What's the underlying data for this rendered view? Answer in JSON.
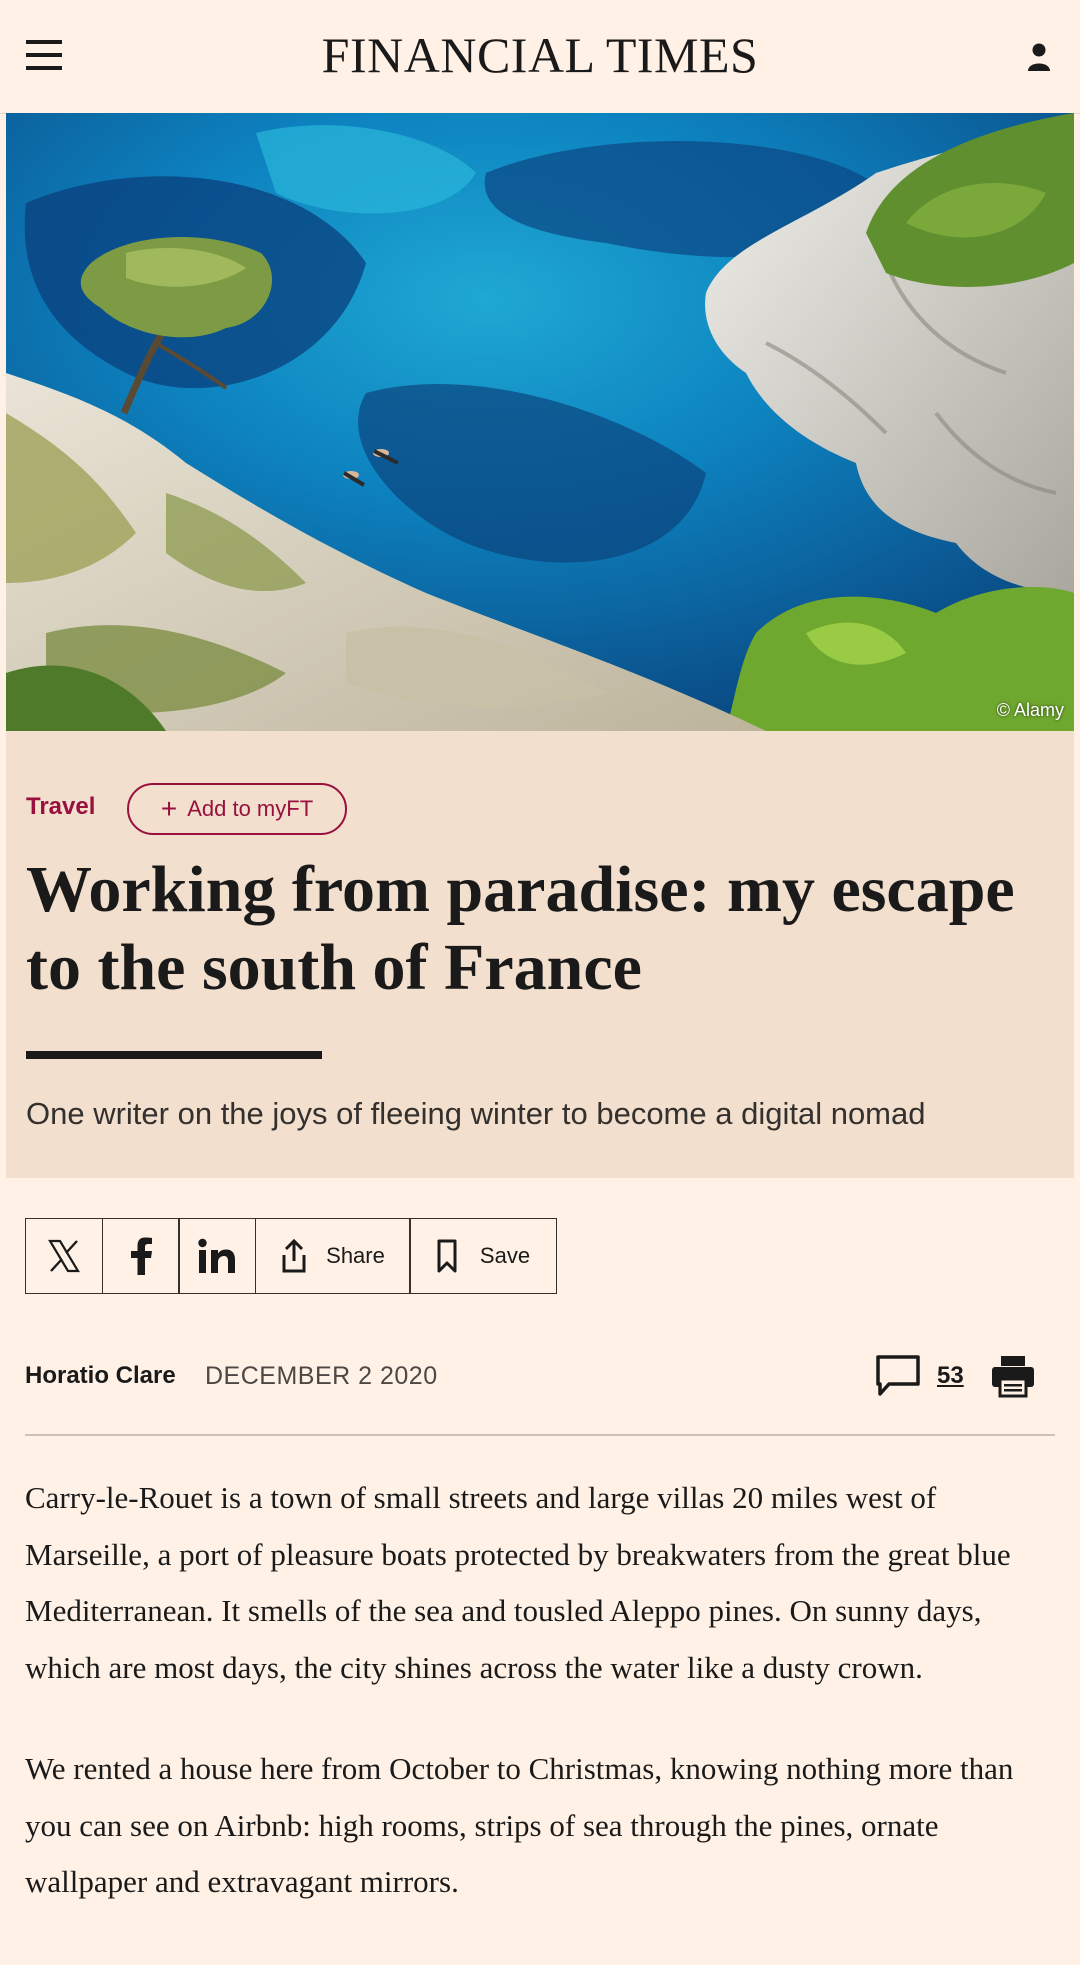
{
  "header": {
    "brand": "FINANCIAL TIMES",
    "menu_icon": "hamburger-menu-icon",
    "account_icon": "user-account-icon"
  },
  "hero": {
    "credit": "© Alamy",
    "image": "aerial view of turquoise Mediterranean cove with white limestone cliffs, pine trees and two swimmers"
  },
  "article": {
    "section": "Travel",
    "add_to_myft": "Add to myFT",
    "headline": "Working from paradise: my escape to the south of France",
    "standfirst": "One writer on the joys of fleeing winter to become a digital nomad",
    "share": {
      "share_label": "Share",
      "save_label": "Save",
      "icons": [
        "x-icon",
        "facebook-icon",
        "linkedin-icon",
        "share-icon",
        "bookmark-icon"
      ]
    },
    "author": "Horatio Clare",
    "date": "DECEMBER 2 2020",
    "comment_count": "53",
    "body": [
      "Carry-le-Rouet is a town of small streets and large villas 20 miles west of Marseille, a port of pleasure boats protected by breakwaters from the great blue Mediterranean. It smells of the sea and tousled Aleppo pines. On sunny days, which are most days, the city shines across the water like a dusty crown.",
      "We rented a house here from October to Christmas, knowing nothing more than you can see on Airbnb: high rooms, strips of sea through the pines, ornate wallpaper and extravagant mirrors."
    ]
  },
  "colors": {
    "background": "#fff1e5",
    "header_block": "#f2dfce",
    "claret": "#990f3d",
    "text": "#1a1a1a"
  }
}
